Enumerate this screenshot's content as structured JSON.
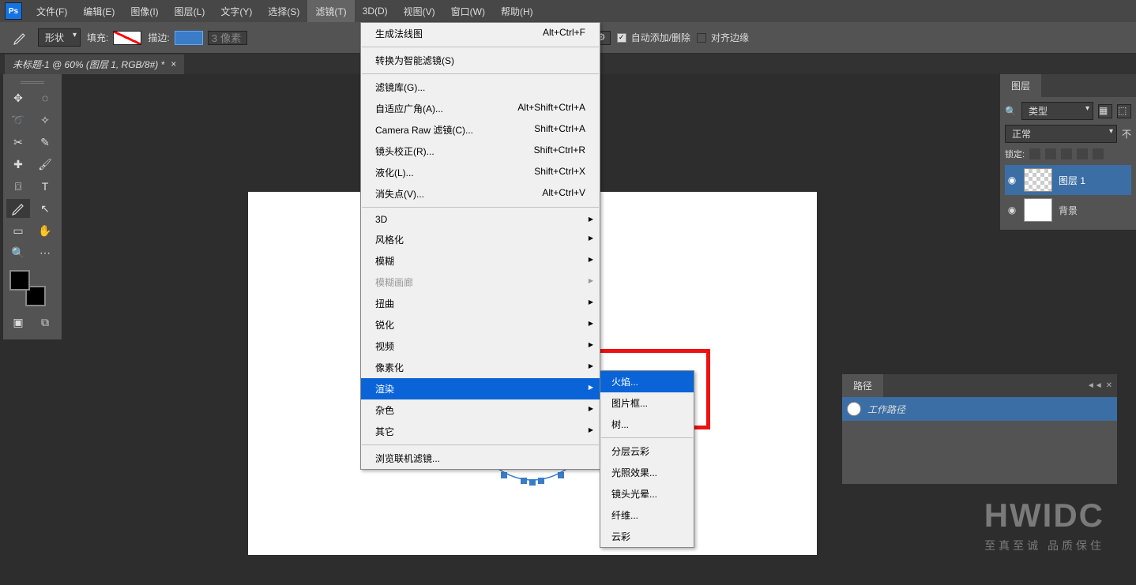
{
  "app": {
    "logo_text": "Ps"
  },
  "menu": {
    "file": "文件(F)",
    "edit": "编辑(E)",
    "image": "图像(I)",
    "layer": "图层(L)",
    "type": "文字(Y)",
    "select": "选择(S)",
    "filter": "滤镜(T)",
    "threeD": "3D(D)",
    "view": "视图(V)",
    "window": "窗口(W)",
    "help": "帮助(H)"
  },
  "options": {
    "shape_label": "形状",
    "fill_label": "填充:",
    "stroke_label": "描边:",
    "stroke_value": "3 像素",
    "auto_add_delete": "自动添加/删除",
    "align_edges": "对齐边缘"
  },
  "doc_tab": {
    "label": "未标题-1 @ 60% (图层 1, RGB/8#) *",
    "close": "×"
  },
  "filter_menu": {
    "normal_map": "生成法线图",
    "normal_map_sc": "Alt+Ctrl+F",
    "smart_filter": "转换为智能滤镜(S)",
    "gallery": "滤镜库(G)...",
    "adaptive": "自适应广角(A)...",
    "adaptive_sc": "Alt+Shift+Ctrl+A",
    "camera_raw": "Camera Raw 滤镜(C)...",
    "camera_raw_sc": "Shift+Ctrl+A",
    "lens": "镜头校正(R)...",
    "lens_sc": "Shift+Ctrl+R",
    "liquify": "液化(L)...",
    "liquify_sc": "Shift+Ctrl+X",
    "vanish": "消失点(V)...",
    "vanish_sc": "Alt+Ctrl+V",
    "threeD": "3D",
    "stylize": "风格化",
    "blur": "模糊",
    "blur_gallery": "模糊画廊",
    "distort": "扭曲",
    "sharpen": "锐化",
    "video": "视频",
    "pixelate": "像素化",
    "render": "渲染",
    "noise": "杂色",
    "other": "其它",
    "browse_online": "浏览联机滤镜..."
  },
  "render_submenu": {
    "flame": "火焰...",
    "picture_frame": "图片框...",
    "tree": "树...",
    "diff_clouds": "分层云彩",
    "lighting": "光照效果...",
    "lens_flare": "镜头光晕...",
    "fibers": "纤维...",
    "clouds": "云彩"
  },
  "layers_panel": {
    "tab": "图层",
    "kind_label": "类型",
    "search_icon": "🔍",
    "blend_mode": "正常",
    "opacity_prefix": "不",
    "lock_label": "锁定:",
    "layer1": "图层 1",
    "background": "背景"
  },
  "paths_panel": {
    "tab": "路径",
    "work_path": "工作路径"
  },
  "watermark": {
    "big": "HWIDC",
    "small": "至真至诚 品质保住"
  }
}
